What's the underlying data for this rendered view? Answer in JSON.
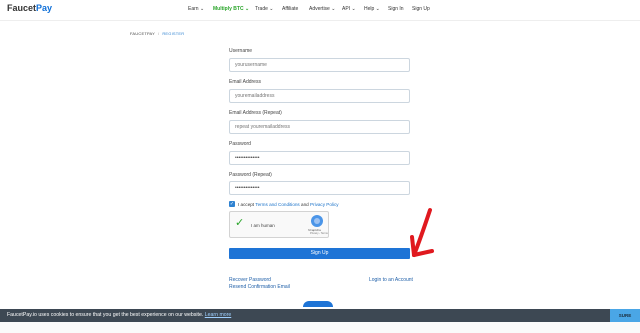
{
  "brand": {
    "part1": "Faucet",
    "part2": "Pay"
  },
  "nav": [
    {
      "label": "Earn ⌄",
      "active": false
    },
    {
      "label": "Multiply BTC ⌄",
      "active": true
    },
    {
      "label": "Trade ⌄",
      "active": false
    },
    {
      "label": "Affiliate",
      "active": false
    },
    {
      "label": "Advertise ⌄",
      "active": false
    },
    {
      "label": "API ⌄",
      "active": false
    },
    {
      "label": "Help ⌄",
      "active": false
    },
    {
      "label": "Sign In",
      "active": false
    },
    {
      "label": "Sign Up",
      "active": false
    }
  ],
  "breadcrumb": {
    "home": "FAUCETPAY",
    "separator": "/",
    "current": "REGISTER"
  },
  "form": {
    "username_label": "Username",
    "username_placeholder": "yourusername",
    "email_label": "Email Address",
    "email_placeholder": "youremailaddress",
    "email_repeat_label": "Email Address (Repeat)",
    "email_repeat_placeholder": "repeat youremailaddress",
    "password_label": "Password",
    "password_value": "••••••••••••••",
    "password_repeat_label": "Password (Repeat)",
    "password_repeat_value": "••••••••••••••",
    "agree_prefix": "I accept",
    "terms_link": "Terms and Conditions",
    "agree_and": "and",
    "privacy_link": "Privacy Policy",
    "captcha_text": "I am human",
    "captcha_brand": "hCaptcha",
    "captcha_privacy": "Privacy - Terms",
    "submit_label": "Sign Up",
    "recover_link": "Recover Password",
    "resend_link": "Resend Confirmation Email",
    "login_link": "Login to an Account"
  },
  "cookie": {
    "message": "FaucetPay.io uses cookies to ensure that you get the best experience on our website.",
    "learn_more": "Learn more",
    "accept": "SURE"
  },
  "colors": {
    "accent": "#1e74d6",
    "active_nav": "#2aa52a",
    "arrow": "#e0191f",
    "cookie_bg": "#3d4853"
  }
}
